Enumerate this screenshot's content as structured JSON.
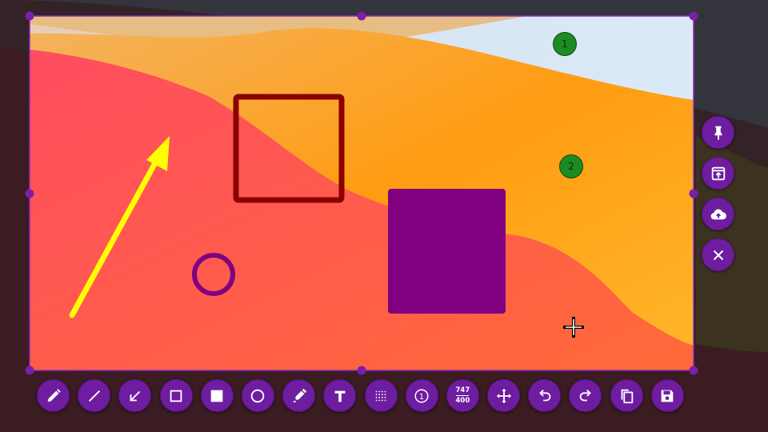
{
  "colors": {
    "accent": "#6e1da0",
    "selection_border": "#8a2bbf",
    "arrow": "#ffff00",
    "square_outline": "#8b0000",
    "filled_rect": "#800080",
    "ellipse": "#800080",
    "step_number": "#1e8b22"
  },
  "canvas": {
    "step_markers": [
      {
        "label": "1"
      },
      {
        "label": "2"
      }
    ]
  },
  "toolbar": {
    "tools": [
      {
        "name": "pencil-tool",
        "icon": "pencil-icon"
      },
      {
        "name": "line-tool",
        "icon": "line-icon"
      },
      {
        "name": "arrow-tool",
        "icon": "arrow-down-left-icon"
      },
      {
        "name": "rectangle-outline-tool",
        "icon": "square-outline-icon"
      },
      {
        "name": "rectangle-filled-tool",
        "icon": "square-filled-icon"
      },
      {
        "name": "circle-tool",
        "icon": "circle-outline-icon"
      },
      {
        "name": "marker-tool",
        "icon": "marker-icon"
      },
      {
        "name": "text-tool",
        "icon": "text-t-icon"
      },
      {
        "name": "pixelate-tool",
        "icon": "blur-grid-icon"
      },
      {
        "name": "counter-tool",
        "icon": "circled-one-icon",
        "label": "1"
      },
      {
        "name": "selection-size",
        "icon": "size-icon",
        "width": "747",
        "height": "400"
      },
      {
        "name": "move-tool",
        "icon": "move-arrows-icon"
      },
      {
        "name": "undo-button",
        "icon": "undo-icon"
      },
      {
        "name": "redo-button",
        "icon": "redo-icon"
      },
      {
        "name": "copy-button",
        "icon": "copy-icon"
      },
      {
        "name": "save-button",
        "icon": "floppy-disk-icon"
      }
    ]
  },
  "side_panel": {
    "buttons": [
      {
        "name": "pin-button",
        "icon": "pin-icon"
      },
      {
        "name": "open-app-button",
        "icon": "open-in-app-icon"
      },
      {
        "name": "upload-button",
        "icon": "cloud-upload-icon"
      },
      {
        "name": "close-button",
        "icon": "close-icon"
      }
    ]
  }
}
